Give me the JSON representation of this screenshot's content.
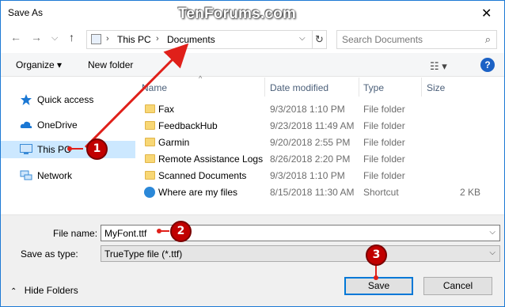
{
  "window": {
    "title": "Save As",
    "watermark": "TenForums.com"
  },
  "navbar": {
    "back": "←",
    "forward": "→",
    "dropdown": "⌵",
    "up": "↑",
    "breadcrumb": [
      "This PC",
      "Documents"
    ],
    "search_placeholder": "Search Documents"
  },
  "command_bar": {
    "organize": "Organize ▾",
    "new_folder": "New folder",
    "help": "?"
  },
  "nav_pane": {
    "items": [
      {
        "label": "Quick access",
        "icon": "star-icon",
        "color": "#1b78d4"
      },
      {
        "label": "OneDrive",
        "icon": "cloud-icon",
        "color": "#1b78d4"
      },
      {
        "label": "This PC",
        "icon": "computer-icon",
        "color": "#3a8bd6",
        "selected": true
      },
      {
        "label": "Network",
        "icon": "network-icon",
        "color": "#3a8bd6"
      }
    ]
  },
  "file_list": {
    "columns": [
      "Name",
      "Date modified",
      "Type",
      "Size"
    ],
    "rows": [
      {
        "name": "Fax",
        "date": "9/3/2018 1:10 PM",
        "type": "File folder",
        "size": "",
        "icon": "folder-icon"
      },
      {
        "name": "FeedbackHub",
        "date": "9/23/2018 11:49 AM",
        "type": "File folder",
        "size": "",
        "icon": "folder-icon"
      },
      {
        "name": "Garmin",
        "date": "9/20/2018 2:55 PM",
        "type": "File folder",
        "size": "",
        "icon": "folder-icon"
      },
      {
        "name": "Remote Assistance Logs",
        "date": "8/26/2018 2:20 PM",
        "type": "File folder",
        "size": "",
        "icon": "folder-icon"
      },
      {
        "name": "Scanned Documents",
        "date": "9/3/2018 1:10 PM",
        "type": "File folder",
        "size": "",
        "icon": "folder-icon"
      },
      {
        "name": "Where are my files",
        "date": "8/15/2018 11:30 AM",
        "type": "Shortcut",
        "size": "2 KB",
        "icon": "shortcut-icon"
      }
    ]
  },
  "form": {
    "file_name_label": "File name:",
    "file_name_value": "MyFont.ttf",
    "save_type_label": "Save as type:",
    "save_type_value": "TrueType file (*.ttf)",
    "hide_folders": "Hide Folders",
    "save_button": "Save",
    "cancel_button": "Cancel"
  },
  "annotations": {
    "badge1": "1",
    "badge2": "2",
    "badge3": "3",
    "color": "#c10000"
  }
}
